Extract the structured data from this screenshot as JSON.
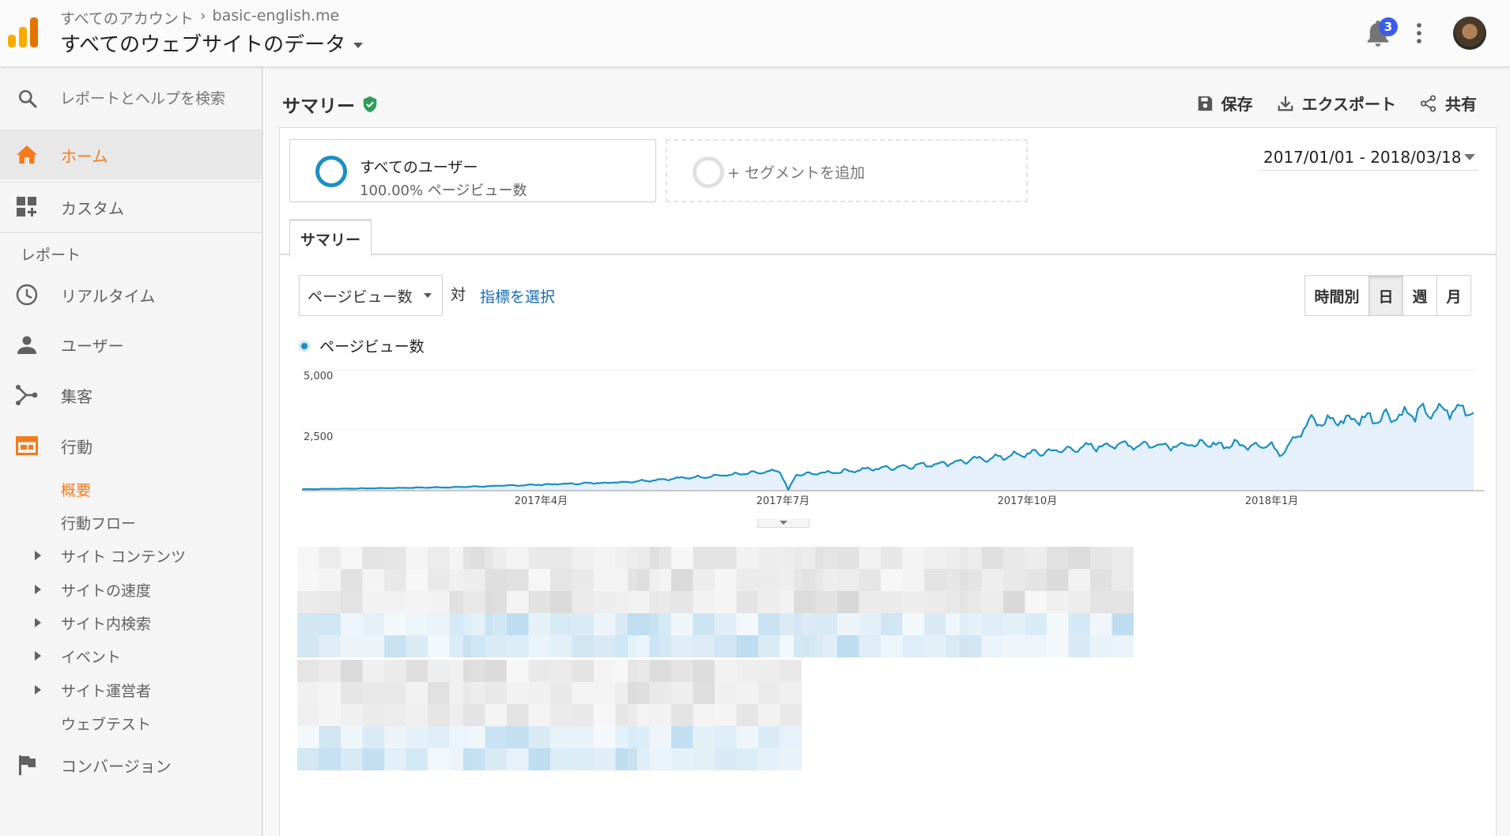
{
  "header": {
    "breadcrumb_account": "すべてのアカウント",
    "breadcrumb_separator": "›",
    "breadcrumb_property": "basic-english.me",
    "view_title": "すべてのウェブサイトのデータ",
    "notification_count": "3"
  },
  "sidebar": {
    "search_placeholder": "レポートとヘルプを検索",
    "home": "ホーム",
    "custom": "カスタム",
    "reports_label": "レポート",
    "realtime": "リアルタイム",
    "users": "ユーザー",
    "acquisition": "集客",
    "behavior": "行動",
    "behavior_sub": {
      "overview": "概要",
      "flow": "行動フロー",
      "site_content": "サイト コンテンツ",
      "site_speed": "サイトの速度",
      "site_search": "サイト内検索",
      "events": "イベント",
      "publisher": "サイト運営者",
      "experiments": "ウェブテスト"
    },
    "conversions": "コンバージョン"
  },
  "main": {
    "title": "サマリー",
    "actions": {
      "save": "保存",
      "export": "エクスポート",
      "share": "共有"
    },
    "segment_all": {
      "name": "すべてのユーザー",
      "value": "100.00% ページビュー数"
    },
    "segment_add": "+ セグメントを追加",
    "date_range": "2017/01/01 - 2018/03/18",
    "tab": "サマリー",
    "metric": "ページビュー数",
    "vs": "対",
    "select_metric": "指標を選択",
    "granularity": [
      "時間別",
      "日",
      "週",
      "月"
    ],
    "legend": "ページビュー数"
  },
  "colors": {
    "accent": "#f37b1d",
    "series": "#1a8fc3",
    "link": "#1a6bb3"
  },
  "chart_data": {
    "type": "area",
    "series": [
      {
        "name": "ページビュー数"
      }
    ],
    "x_ticks": [
      "2017年4月",
      "2017年7月",
      "2017年10月",
      "2018年1月"
    ],
    "y_ticks": [
      "5,000",
      "2,500"
    ],
    "ylim": [
      0,
      5000
    ],
    "x_start": "2017-01-01",
    "x_end": "2018-03-18",
    "grid": true,
    "daily_profile": [
      {
        "date": "2017-01-01",
        "value": 60
      },
      {
        "date": "2017-03-01",
        "value": 150
      },
      {
        "date": "2017-05-01",
        "value": 350
      },
      {
        "date": "2017-06-30",
        "value": 800
      },
      {
        "date": "2017-07-03",
        "value": 30
      },
      {
        "date": "2017-07-06",
        "value": 650
      },
      {
        "date": "2017-09-01",
        "value": 1150
      },
      {
        "date": "2017-11-01",
        "value": 1900
      },
      {
        "date": "2017-12-31",
        "value": 1900
      },
      {
        "date": "2018-01-04",
        "value": 1550
      },
      {
        "date": "2018-01-15",
        "value": 2800
      },
      {
        "date": "2018-03-18",
        "value": 3400
      }
    ]
  }
}
